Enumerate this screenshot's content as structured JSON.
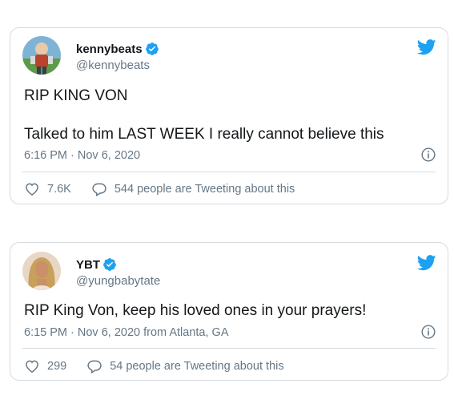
{
  "colors": {
    "twitter_blue": "#1da1f2",
    "secondary_text": "#657786",
    "primary_text": "#14171a",
    "border": "#d6dbe0"
  },
  "tweets": [
    {
      "display_name": "kennybeats",
      "handle": "@kennybeats",
      "verified": true,
      "lines": [
        "RIP KING VON",
        "Talked to him LAST WEEK I really cannot believe this"
      ],
      "meta": "6:16 PM · Nov 6, 2020",
      "likes": "7.6K",
      "conversation": "544 people are Tweeting about this"
    },
    {
      "display_name": "YBT",
      "handle": "@yungbabytate",
      "verified": true,
      "lines": [
        "RIP King Von, keep his loved ones in your prayers!"
      ],
      "meta": "6:15 PM · Nov 6, 2020 from Atlanta, GA",
      "likes": "299",
      "conversation": "54 people are Tweeting about this"
    }
  ],
  "icons": {
    "verified": "verified-badge-icon",
    "bird": "twitter-bird-icon",
    "info": "info-icon",
    "like": "heart-icon",
    "conversation": "speech-bubble-icon"
  }
}
